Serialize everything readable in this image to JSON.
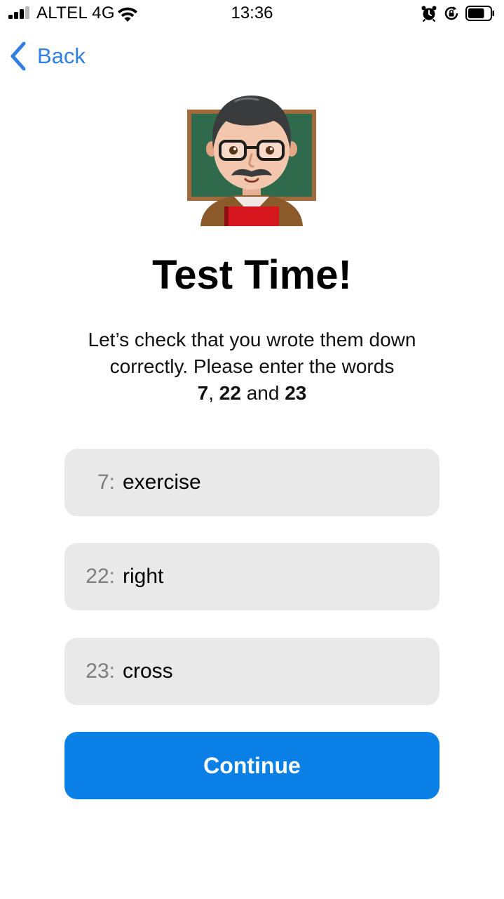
{
  "status_bar": {
    "carrier": "ALTEL 4G",
    "time": "13:36",
    "signal_bars_filled": 3,
    "signal_bars_total": 4,
    "icons": [
      "signal-icon",
      "wifi-icon",
      "alarm-icon",
      "rotation-lock-icon",
      "battery-icon"
    ],
    "battery_level": 0.75
  },
  "nav": {
    "back_label": "Back",
    "back_icon": "chevron-left-icon",
    "accent_color": "#2f80e0"
  },
  "hero": {
    "icon": "teacher-emoji-icon"
  },
  "title": "Test Time!",
  "description": {
    "line1": "Let’s check that you wrote them down",
    "line2": "correctly. Please enter the words",
    "word_a": "7",
    "separator": ", ",
    "word_b": "22",
    "conjunction": " and ",
    "word_c": "23"
  },
  "fields": [
    {
      "number_label": "7:",
      "value": "exercise"
    },
    {
      "number_label": "22:",
      "value": "right"
    },
    {
      "number_label": "23:",
      "value": "cross"
    }
  ],
  "continue": {
    "label": "Continue",
    "color": "#0a7fe5"
  },
  "colors": {
    "field_background": "#e9e9e9",
    "number_label": "#7c7c7c"
  }
}
